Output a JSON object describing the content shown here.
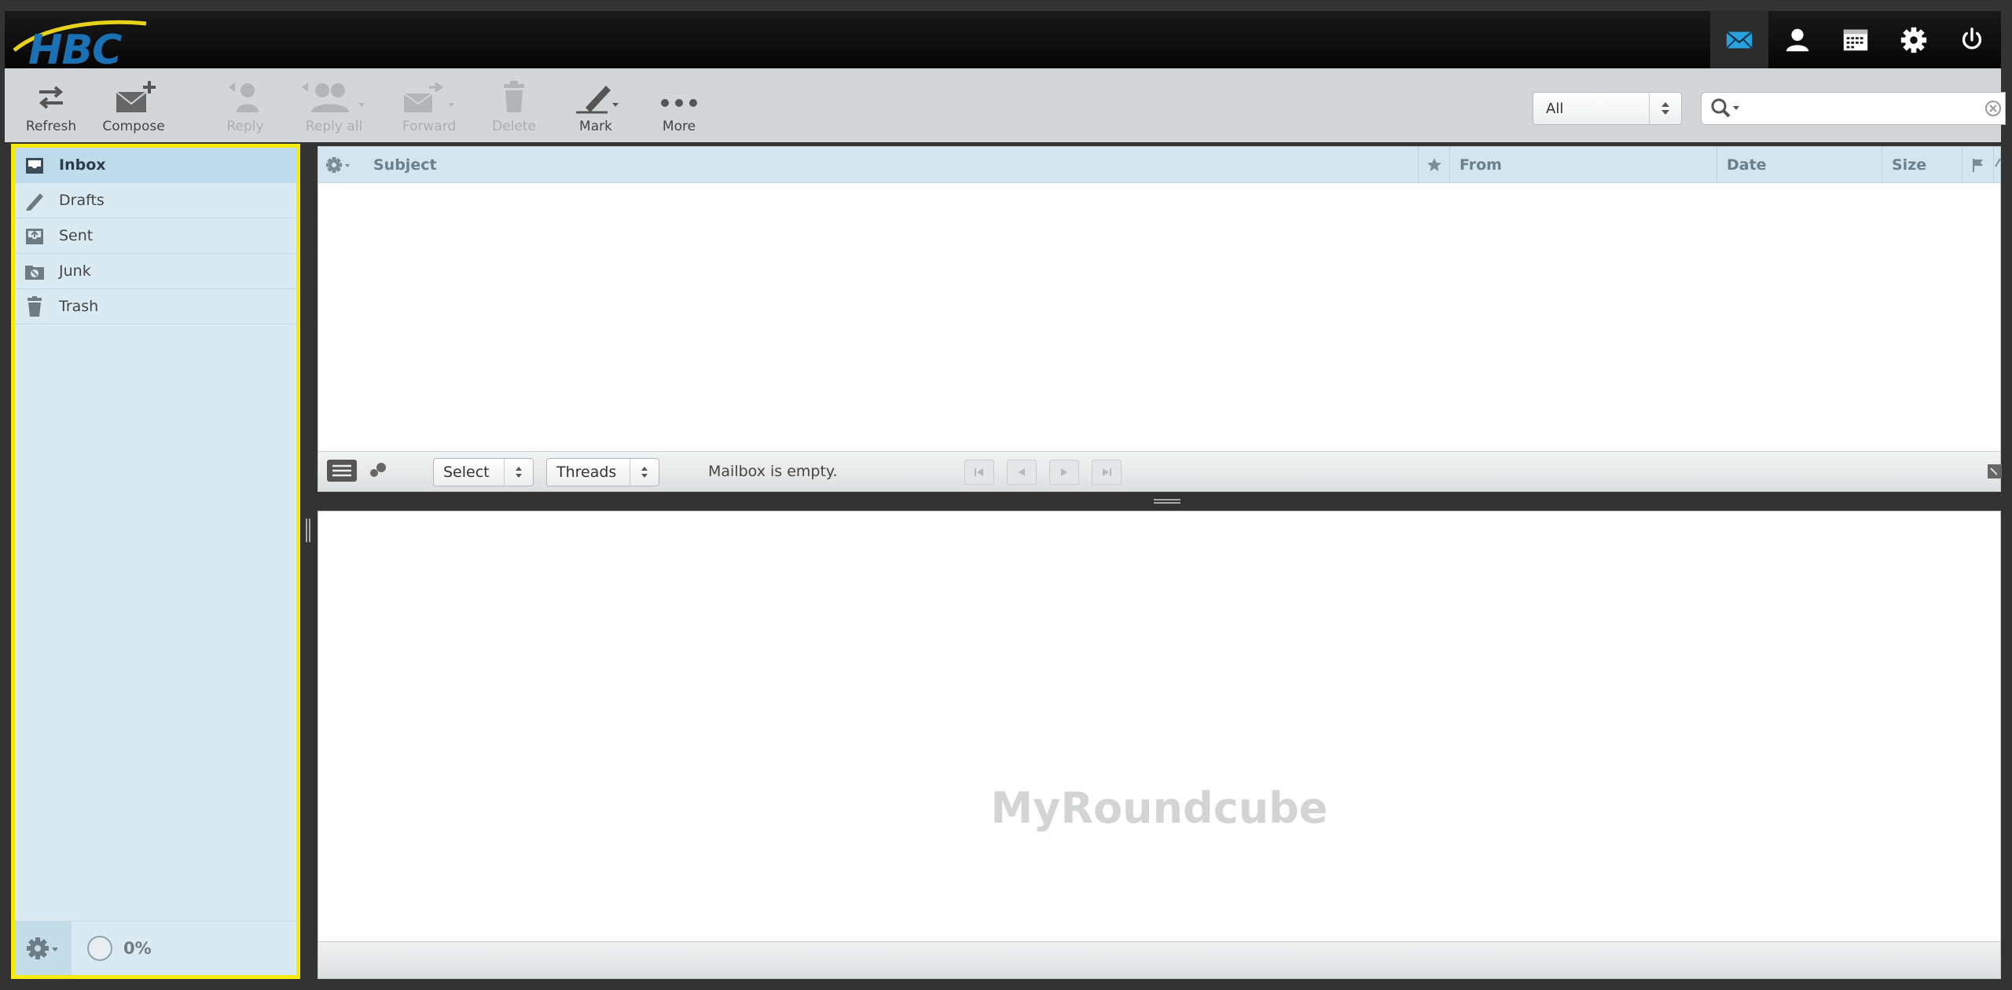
{
  "logo": {
    "text": "HBC"
  },
  "taskbar": [
    {
      "name": "mail-task",
      "icon": "envelope-icon",
      "active": true
    },
    {
      "name": "contacts-task",
      "icon": "person-icon"
    },
    {
      "name": "calendar-task",
      "icon": "calendar-icon"
    },
    {
      "name": "settings-task",
      "icon": "gear-icon"
    },
    {
      "name": "logout-task",
      "icon": "power-icon"
    }
  ],
  "toolbar": {
    "refresh": "Refresh",
    "compose": "Compose",
    "reply": "Reply",
    "reply_all": "Reply all",
    "forward": "Forward",
    "delete": "Delete",
    "mark": "Mark",
    "more": "More"
  },
  "filter": {
    "value": "All"
  },
  "search": {
    "value": ""
  },
  "folders": [
    {
      "label": "Inbox",
      "icon": "inbox-icon",
      "selected": true
    },
    {
      "label": "Drafts",
      "icon": "pencil-icon"
    },
    {
      "label": "Sent",
      "icon": "sent-icon"
    },
    {
      "label": "Junk",
      "icon": "junk-icon"
    },
    {
      "label": "Trash",
      "icon": "trash-icon"
    }
  ],
  "quota": {
    "percent": "0%"
  },
  "list_columns": {
    "subject": "Subject",
    "from": "From",
    "date": "Date",
    "size": "Size"
  },
  "list_footer": {
    "select": "Select",
    "threads": "Threads",
    "status": "Mailbox is empty."
  },
  "preview": {
    "watermark": "MyRoundcube"
  },
  "colors": {
    "accent": "#1a72b5",
    "folder_bg": "#d9eaf3",
    "highlight_border": "#f6ea0b"
  }
}
